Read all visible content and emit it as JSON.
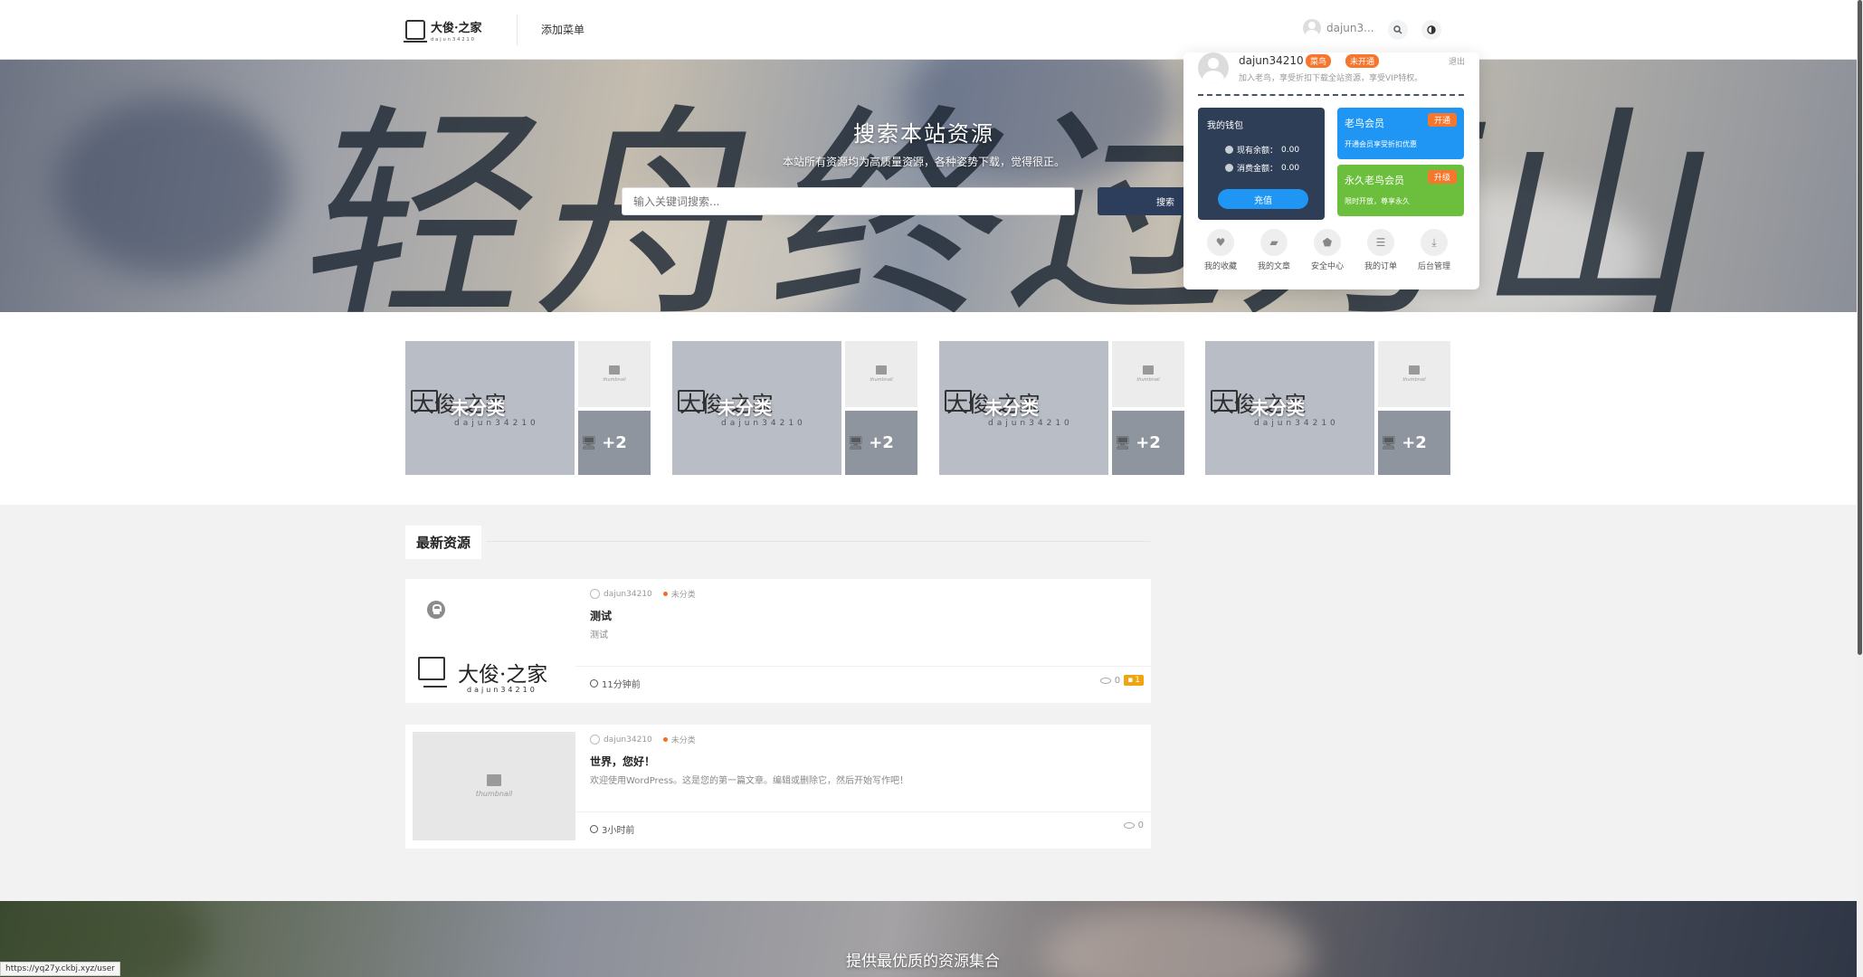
{
  "header": {
    "logo_text": "大俊·之家",
    "logo_sub": "dajun34210",
    "nav_add_menu": "添加菜单",
    "user_short": "dajun3...",
    "search_icon": "search-icon",
    "theme_icon": "theme-toggle-icon"
  },
  "hero": {
    "calligraphy": "轻舟终过万山",
    "title": "搜索本站资源",
    "subtitle": "本站所有资源均为高质量资源，各种姿势下载，觉得很正。",
    "search_placeholder": "输入关键词搜索...",
    "search_button": "搜索"
  },
  "categories": [
    {
      "label": "未分类",
      "more": "+2",
      "thumb_caption": "thumbnail"
    },
    {
      "label": "未分类",
      "more": "+2",
      "thumb_caption": "thumbnail"
    },
    {
      "label": "未分类",
      "more": "+2",
      "thumb_caption": "thumbnail"
    },
    {
      "label": "未分类",
      "more": "+2",
      "thumb_caption": "thumbnail"
    }
  ],
  "section": {
    "title": "最新资源"
  },
  "posts": [
    {
      "author": "dajun34210",
      "category": "未分类",
      "title": "测试",
      "excerpt": "测试",
      "time": "11分钟前",
      "views": "0",
      "comments": "1",
      "locked": true
    },
    {
      "author": "dajun34210",
      "category": "未分类",
      "title": "世界，您好！",
      "excerpt": "欢迎使用WordPress。这是您的第一篇文章。编辑或删除它，然后开始写作吧！",
      "time": "3小时前",
      "views": "0",
      "thumb_caption": "thumbnail"
    }
  ],
  "footer_banner": {
    "text": "提供最优质的资源集合"
  },
  "status_url": "https://yq27y.ckbj.xyz/user",
  "panel": {
    "username": "dajun34210",
    "badge_level": "菜鸟",
    "badge_vip": "未开通",
    "logout": "退出",
    "desc": "加入老鸟，享受折扣下载全站资源，享受VIP特权。",
    "wallet": {
      "title": "我的钱包",
      "balance_label": "现有余额：",
      "balance_value": "0.00",
      "spent_label": "消费金额：",
      "spent_value": "0.00",
      "recharge": "充值"
    },
    "vip_cards": [
      {
        "name": "老鸟会员",
        "tag": "开通",
        "desc": "开通会员享受折扣优惠",
        "color": "#1f96f3"
      },
      {
        "name": "永久老鸟会员",
        "tag": "升级",
        "desc": "限时开放，尊享永久",
        "color": "#6cbf3d"
      }
    ],
    "quick_links": [
      {
        "label": "我的收藏",
        "icon": "heart-icon"
      },
      {
        "label": "我的文章",
        "icon": "folder-icon"
      },
      {
        "label": "安全中心",
        "icon": "shield-icon"
      },
      {
        "label": "我的订单",
        "icon": "order-icon"
      },
      {
        "label": "后台管理",
        "icon": "download-icon"
      }
    ]
  }
}
